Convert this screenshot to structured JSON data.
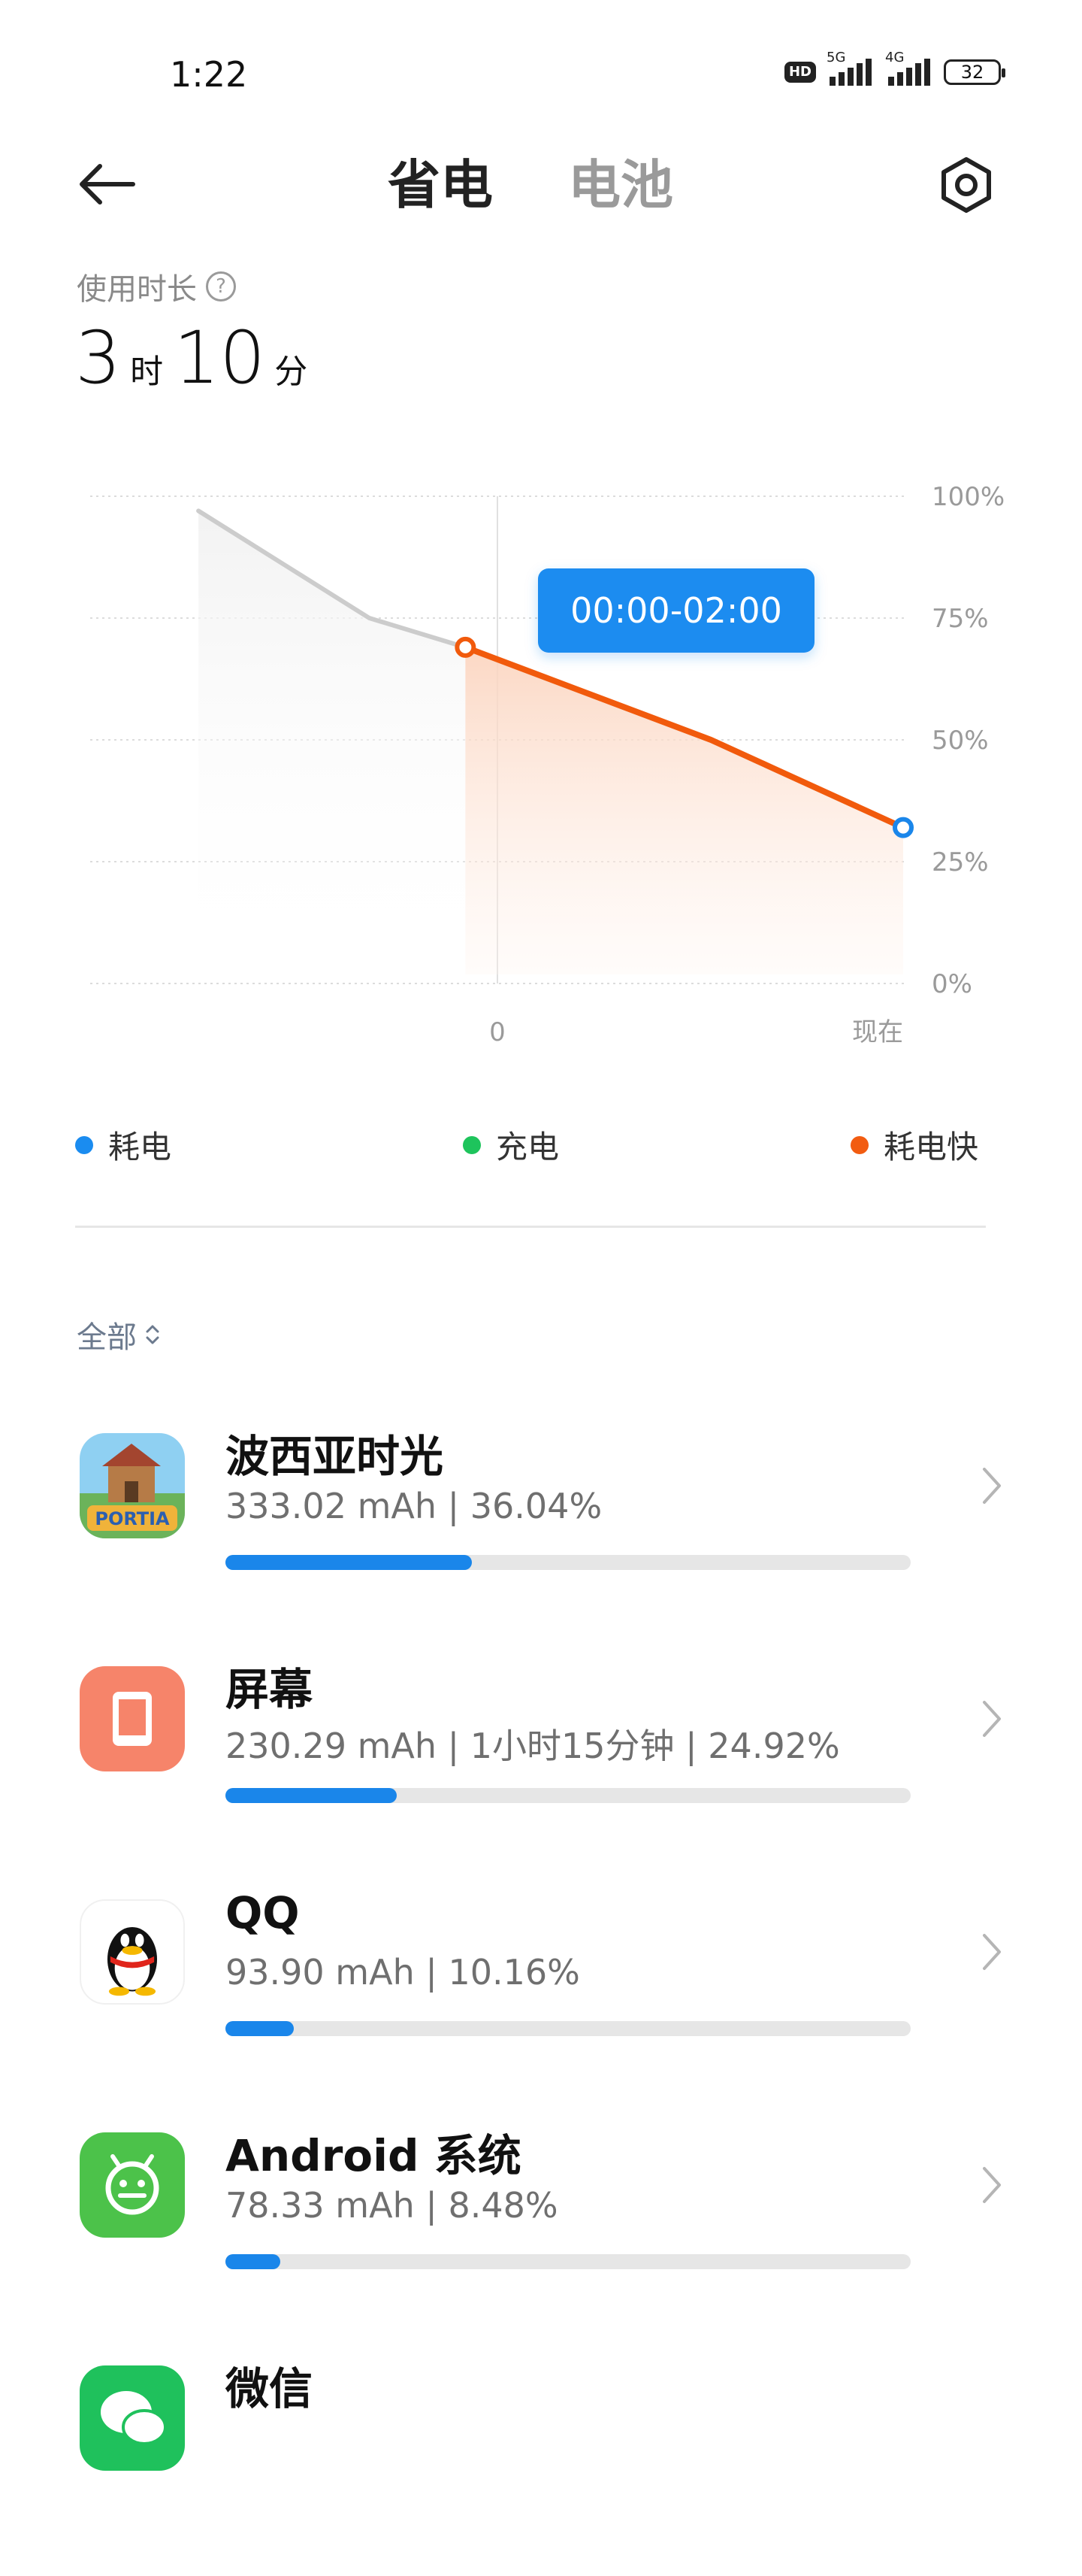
{
  "status_bar": {
    "time": "1:22",
    "hd": "HD",
    "net1": "5G",
    "net2": "4G",
    "battery": "32"
  },
  "header": {
    "tab_saver": "省电",
    "tab_battery": "电池"
  },
  "usage": {
    "label": "使用时长",
    "hours": "3",
    "hours_unit": "时",
    "minutes": "10",
    "minutes_unit": "分"
  },
  "chart_data": {
    "type": "line",
    "x_labels": [
      "0",
      "现在"
    ],
    "y_ticks": [
      "100%",
      "75%",
      "50%",
      "25%",
      "0%"
    ],
    "ylim": [
      0,
      100
    ],
    "tooltip": "00:00-02:00",
    "series": [
      {
        "name": "耗电",
        "color": "#cccccc",
        "points": [
          {
            "x": -1.4,
            "y": 97
          },
          {
            "x": -0.6,
            "y": 75
          },
          {
            "x": -0.15,
            "y": 69
          }
        ]
      },
      {
        "name": "耗电快",
        "color": "#f15a0c",
        "points": [
          {
            "x": -0.15,
            "y": 69
          },
          {
            "x": 1.0,
            "y": 50
          },
          {
            "x": 1.9,
            "y": 32
          }
        ]
      }
    ]
  },
  "legend": [
    {
      "label": "耗电",
      "color": "#1a8cf0"
    },
    {
      "label": "充电",
      "color": "#1ec45c"
    },
    {
      "label": "耗电快",
      "color": "#f25c11"
    }
  ],
  "filter": {
    "label": "全部"
  },
  "apps": [
    {
      "name": "波西亚时光",
      "detail": "333.02 mAh | 36.04%",
      "fraction": 0.36,
      "icon": "portia-game-icon"
    },
    {
      "name": "屏幕",
      "detail": "230.29 mAh | 1小时15分钟 | 24.92%",
      "fraction": 0.25,
      "icon": "screen-icon"
    },
    {
      "name": "QQ",
      "detail": "93.90 mAh | 10.16%",
      "fraction": 0.1,
      "icon": "qq-penguin-icon"
    },
    {
      "name": "Android 系统",
      "detail": "78.33 mAh | 8.48%",
      "fraction": 0.08,
      "icon": "android-icon"
    },
    {
      "name": "微信",
      "detail": "",
      "fraction": 0,
      "icon": "wechat-icon"
    }
  ]
}
